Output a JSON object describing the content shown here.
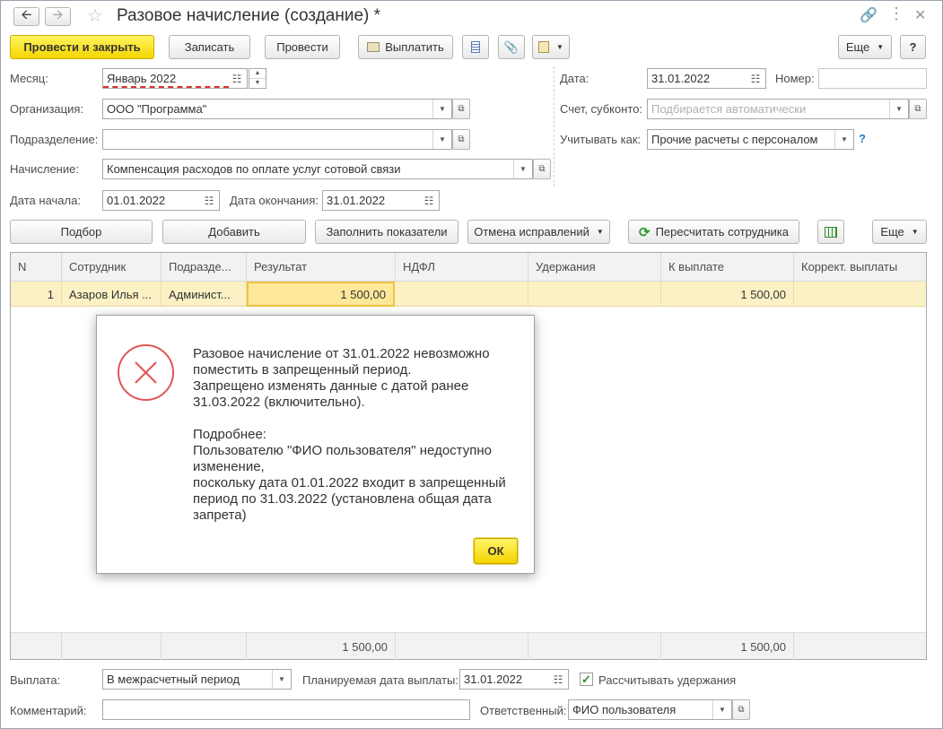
{
  "window": {
    "title": "Разовое начисление (создание) *",
    "back_icon": "arrow-left-icon",
    "forward_icon": "arrow-right-icon"
  },
  "toolbar": {
    "post_close": "Провести и закрыть",
    "save": "Записать",
    "post": "Провести",
    "pay": "Выплатить",
    "more": "Еще",
    "help": "?"
  },
  "form": {
    "month_label": "Месяц:",
    "month_value": "Январь 2022",
    "org_label": "Организация:",
    "org_value": "ООО \"Программа\"",
    "dept_label": "Подразделение:",
    "dept_value": "",
    "accrual_label": "Начисление:",
    "accrual_value": "Компенсация расходов по оплате услуг сотовой связи",
    "start_label": "Дата начала:",
    "start_value": "01.01.2022",
    "end_label": "Дата окончания:",
    "end_value": "31.01.2022",
    "date_label": "Дата:",
    "date_value": "31.01.2022",
    "number_label": "Номер:",
    "number_value": "",
    "account_label": "Счет, субконто:",
    "account_placeholder": "Подбирается автоматически",
    "consider_label": "Учитывать как:",
    "consider_value": "Прочие расчеты с персоналом",
    "consider_help": "?"
  },
  "table_toolbar": {
    "select": "Подбор",
    "add": "Добавить",
    "fill": "Заполнить показатели",
    "cancel_fix": "Отмена исправлений",
    "recalc": "Пересчитать сотрудника",
    "more": "Еще"
  },
  "table": {
    "headers": [
      "N",
      "Сотрудник",
      "Подразде...",
      "Результат",
      "НДФЛ",
      "Удержания",
      "К выплате",
      "Коррект. выплаты"
    ],
    "rows": [
      {
        "n": "1",
        "employee": "Азаров Илья ...",
        "dept": "Админист...",
        "result": "1 500,00",
        "ndfl": "",
        "deductions": "",
        "to_pay": "1 500,00",
        "correction": ""
      }
    ],
    "totals": {
      "result": "1 500,00",
      "to_pay": "1 500,00"
    }
  },
  "dialog": {
    "icon": "error-x-icon",
    "message": "Разовое начисление  от 31.01.2022 невозможно поместить в запрещенный период.\nЗапрещено изменять данные с датой ранее 31.03.2022 (включительно).\n\nПодробнее:\nПользователю \"ФИО пользователя\" недоступно изменение,\nпоскольку дата 01.01.2022 входит в запрещенный период по 31.03.2022 (установлена общая дата запрета)",
    "ok": "ОК"
  },
  "bottom": {
    "payment_label": "Выплата:",
    "payment_value": "В межрасчетный период",
    "planned_label": "Планируемая дата выплаты:",
    "planned_value": "31.01.2022",
    "calc_deductions_label": "Рассчитывать удержания",
    "calc_deductions_checked": true,
    "comment_label": "Комментарий:",
    "comment_value": "",
    "responsible_label": "Ответственный:",
    "responsible_value": "ФИО пользователя"
  },
  "colors": {
    "primary_button": "#f5d600",
    "selected_row": "#fbf1c4",
    "error_red": "#e25555",
    "help_blue": "#1f78c6"
  }
}
